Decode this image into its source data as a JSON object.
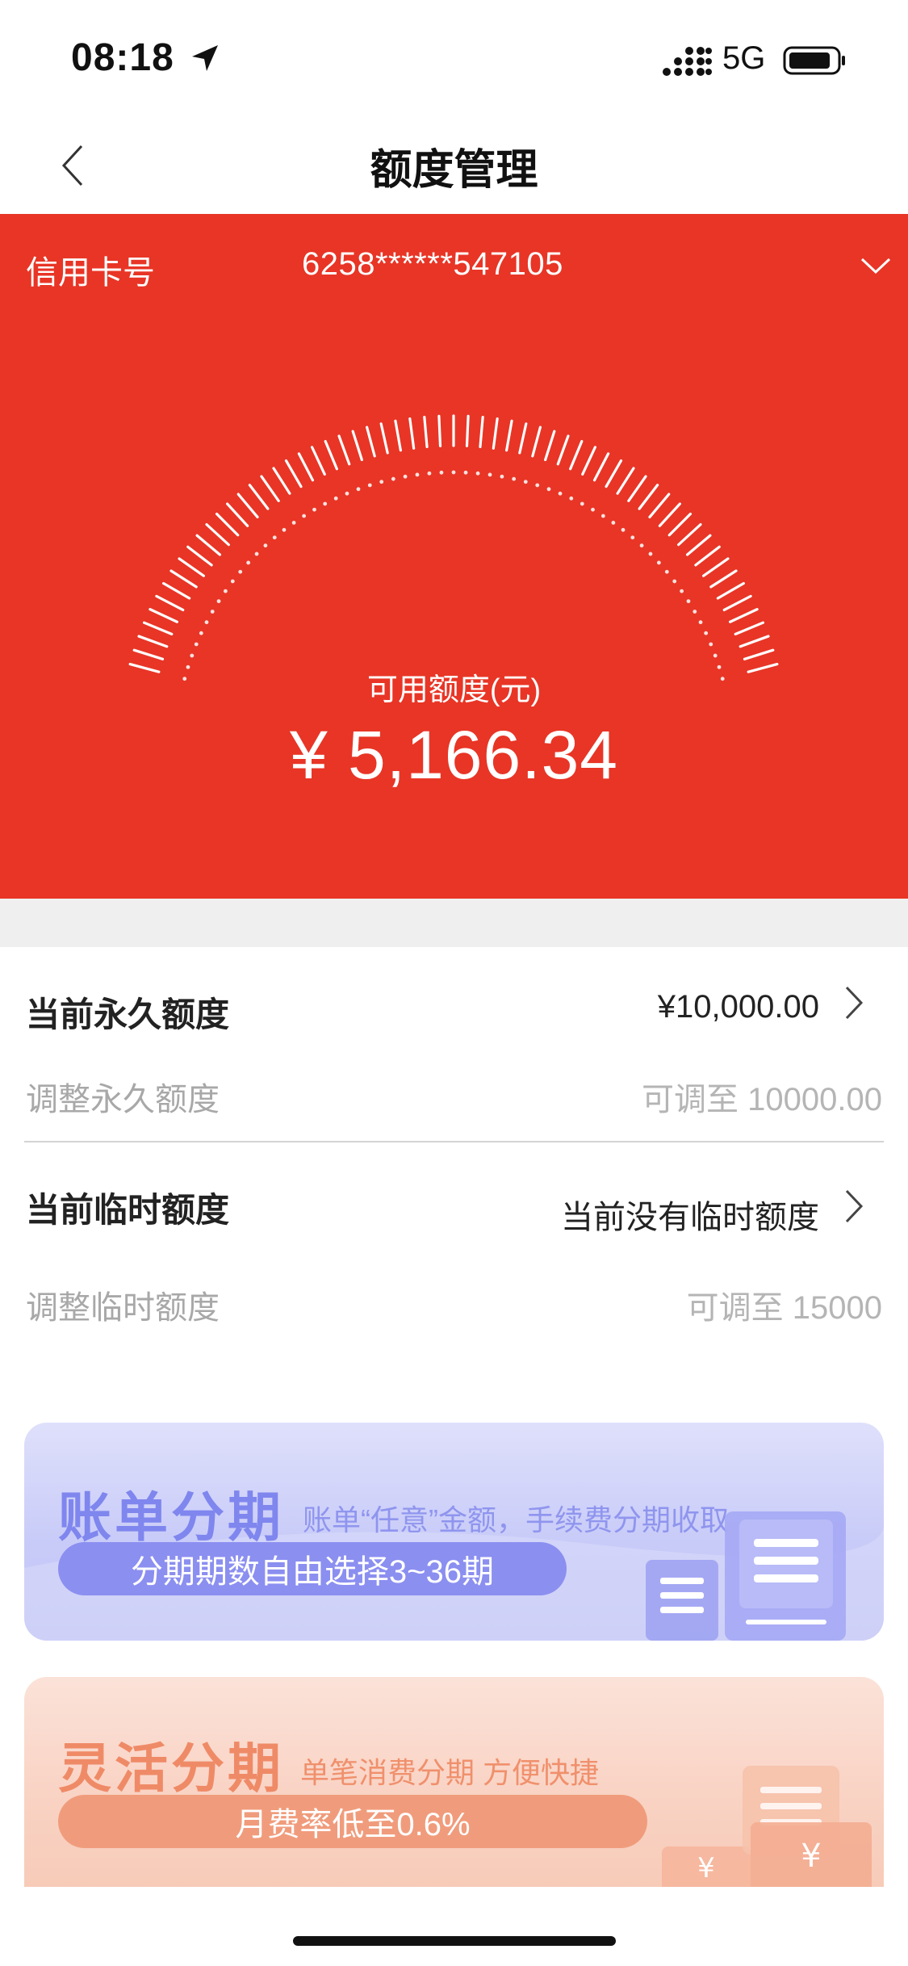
{
  "status_bar": {
    "time": "08:18",
    "network": "5G"
  },
  "nav": {
    "title": "额度管理"
  },
  "card": {
    "label": "信用卡号",
    "number": "6258******547105"
  },
  "available": {
    "label": "可用额度(元)",
    "amount": "¥ 5,166.34"
  },
  "permanent": {
    "title": "当前永久额度",
    "value": "¥10,000.00",
    "adjust_label": "调整永久额度",
    "adjust_value": "可调至 10000.00"
  },
  "temporary": {
    "title": "当前临时额度",
    "value": "当前没有临时额度",
    "adjust_label": "调整临时额度",
    "adjust_value": "可调至 15000"
  },
  "promo_bill": {
    "title": "账单分期",
    "desc": "账单“任意”金额，手续费分期收取",
    "pill": "分期期数自由选择3~36期"
  },
  "promo_flex": {
    "title": "灵活分期",
    "desc": "单笔消费分期 方便快捷",
    "pill": "月费率低至0.6%"
  },
  "colors": {
    "hero_red": "#e83526",
    "bill_accent": "#7f86ee",
    "flex_accent": "#ef8a67"
  }
}
